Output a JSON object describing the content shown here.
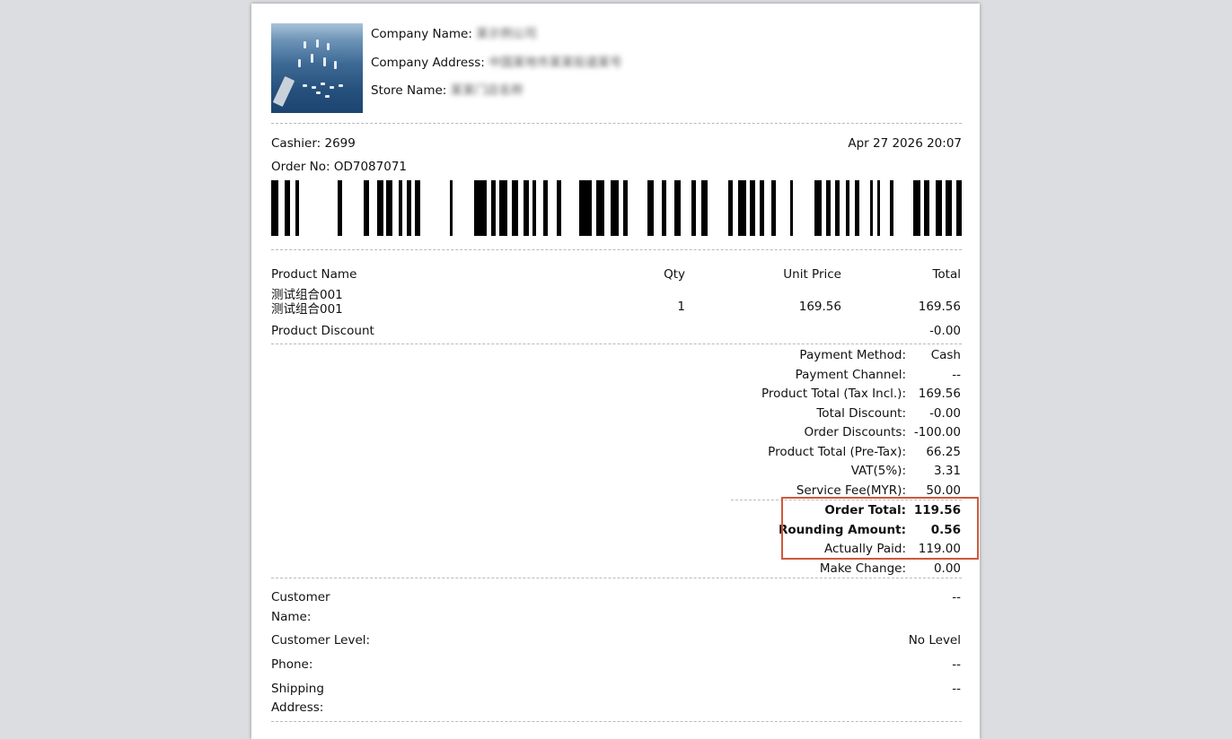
{
  "header": {
    "company_name_label": "Company Name:",
    "company_name_value": "某示例公司",
    "company_address_label": "Company Address:",
    "company_address_value": "中国某地市某某街道某号",
    "store_name_label": "Store Name:",
    "store_name_value": "某某门店名称"
  },
  "order": {
    "cashier": "Cashier: 2699",
    "datetime": "Apr 27 2026 20:07",
    "order_no": "Order No: OD7087071"
  },
  "table": {
    "headers": {
      "name": "Product Name",
      "qty": "Qty",
      "unit_price": "Unit Price",
      "total": "Total"
    },
    "rows": [
      {
        "name_line1": "测试组合001",
        "name_line2": "测试组合001",
        "qty": "1",
        "unit_price": "169.56",
        "total": "169.56"
      }
    ],
    "discount_label": "Product Discount",
    "discount_value": "-0.00"
  },
  "summary": [
    {
      "label": "Payment Method:",
      "value": "Cash"
    },
    {
      "label": "Payment Channel:",
      "value": "--"
    },
    {
      "label": "Product Total (Tax Incl.):",
      "value": "169.56"
    },
    {
      "label": "Total Discount:",
      "value": "-0.00"
    },
    {
      "label": "Order Discounts:",
      "value": "-100.00"
    },
    {
      "label": "Product Total (Pre-Tax):",
      "value": "66.25"
    },
    {
      "label": "VAT(5%):",
      "value": "3.31"
    },
    {
      "label": "Service Fee(MYR):",
      "value": "50.00"
    },
    {
      "label": "Order Total:",
      "value": "119.56"
    },
    {
      "label": "Rounding Amount:",
      "value": "0.56"
    },
    {
      "label": "Actually Paid:",
      "value": "119.00"
    },
    {
      "label": "Make Change:",
      "value": "0.00"
    }
  ],
  "customer": {
    "name_label_1": "Customer",
    "name_label_2": "Name:",
    "name_value": "--",
    "level_label": "Customer Level:",
    "level_value": "No Level",
    "phone_label": "Phone:",
    "phone_value": "--",
    "shipping_label_1": "Shipping",
    "shipping_label_2": "Address:",
    "shipping_value": "--"
  },
  "colors": {
    "highlight": "#d0583b",
    "background": "#dcdde1"
  }
}
